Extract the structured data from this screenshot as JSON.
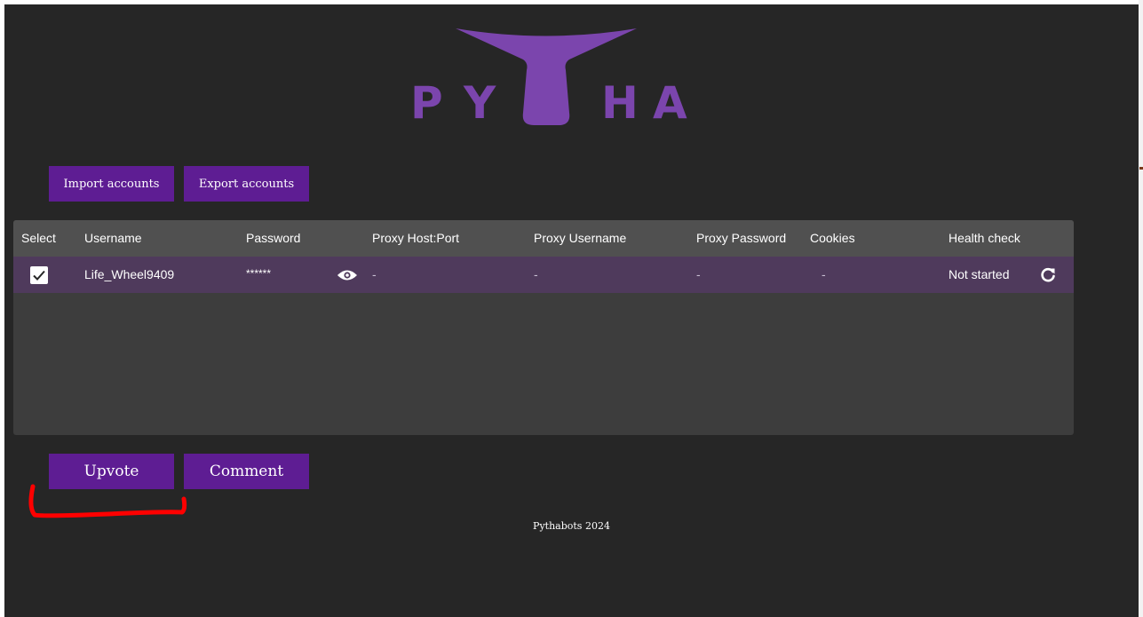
{
  "logo": {
    "letters": [
      "P",
      "Y",
      "H",
      "A"
    ],
    "color": "#7b45ad"
  },
  "toolbar": {
    "import_label": "Import accounts",
    "export_label": "Export accounts"
  },
  "table": {
    "headers": {
      "select": "Select",
      "username": "Username",
      "password": "Password",
      "proxy_host_port": "Proxy Host:Port",
      "proxy_username": "Proxy Username",
      "proxy_password": "Proxy Password",
      "cookies": "Cookies",
      "health_check": "Health check"
    },
    "rows": [
      {
        "selected": true,
        "username": "Life_Wheel9409",
        "password": "******",
        "proxy_host_port": "-",
        "proxy_username": "-",
        "proxy_password": "-",
        "cookies": "-",
        "health_check": "Not started"
      }
    ]
  },
  "actions": {
    "upvote_label": "Upvote",
    "comment_label": "Comment"
  },
  "footer": {
    "text": "Pythabots 2024"
  },
  "icons": {
    "checkbox": "checkbox-checked-icon",
    "toggle_password": "eye-icon",
    "refresh": "refresh-icon",
    "logo_mark": "logo-mark-icon"
  },
  "colors": {
    "background": "#262626",
    "accent": "#5e1d93",
    "logo": "#7b45ad",
    "selected_row": "#4f3a5c",
    "annotation": "#ff0000"
  }
}
